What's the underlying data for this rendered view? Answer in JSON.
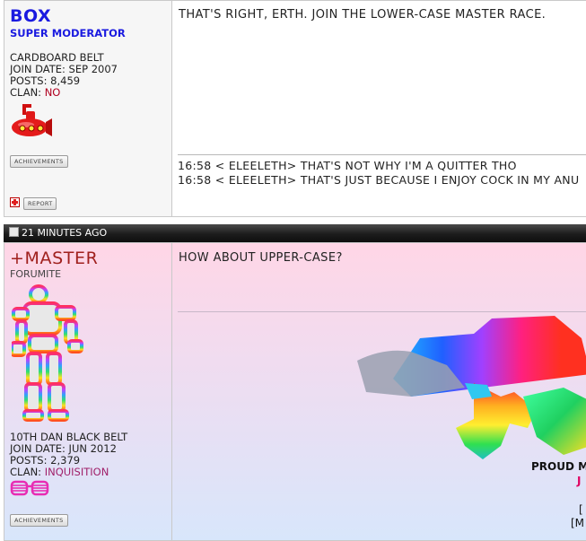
{
  "post1": {
    "username": "BOX",
    "user_title": "SUPER MODERATOR",
    "rank": "CARDBOARD BELT",
    "join_label": "JOIN DATE:",
    "join_date": "SEP 2007",
    "posts_label": "POSTS:",
    "posts": "8,459",
    "clan_label": "CLAN:",
    "clan": "NO",
    "achievements_label": "ACHIEVEMENTS",
    "report_label": "REPORT",
    "message": "THAT'S RIGHT, ERTH. JOIN THE LOWER-CASE MASTER RACE.",
    "chat_lines": [
      "16:58 < ELEELETH> THAT'S NOT WHY I'M A QUITTER THO",
      "16:58 < ELEELETH> THAT'S JUST BECAUSE I ENJOY COCK IN MY ANU"
    ]
  },
  "post2": {
    "date": "21 MINUTES AGO",
    "username": "+MASTER",
    "user_title": "FORUMITE",
    "rank": "10TH DAN BLACK BELT",
    "join_label": "JOIN DATE:",
    "join_date": "JUN 2012",
    "posts_label": "POSTS:",
    "posts": "2,379",
    "clan_label": "CLAN:",
    "clan": "INQUISITION",
    "achievements_label": "ACHIEVEMENTS",
    "message": "HOW ABOUT UPPER-CASE?",
    "sig_bold": "PROUD M",
    "sig_j": "J",
    "sig_bracket1": "[",
    "sig_bracket2": "[M"
  },
  "colors": {
    "moderator_blue": "#1a1ae0",
    "master_red": "#a0201e",
    "clan_red": "#b00020",
    "clan_purple": "#a0206a"
  }
}
